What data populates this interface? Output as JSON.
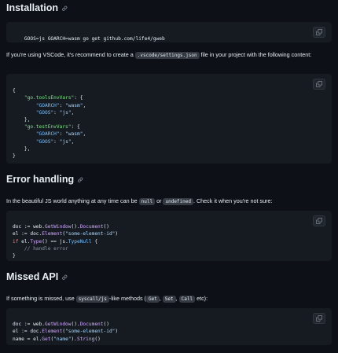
{
  "installation": {
    "heading": "Installation",
    "install_cmd": "GOOS=js GOARCH=wasm go get github.com/life4/gweb",
    "vscode_text_before": "If you're using VSCode, it's recommend to create a",
    "vscode_settings_path": ".vscode/settings.json",
    "vscode_text_after": "file in your project with the following content:",
    "settings_lines": [
      "{",
      "    \"go.toolsEnvVars\": {",
      "        \"GOARCH\": \"wasm\",",
      "        \"GOOS\": \"js\",",
      "    },",
      "    \"go.testEnvVars\": {",
      "        \"GOARCH\": \"wasm\",",
      "        \"GOOS\": \"js\",",
      "    },",
      "}"
    ]
  },
  "error_handling": {
    "heading": "Error handling",
    "text_before": "In the beautiful JS world anything at any time can be",
    "null_code": "null",
    "or_text": "or",
    "undefined_code": "undefined",
    "text_after": ". Check it when you're not sure:",
    "code": {
      "line1_a": "doc := web.",
      "line1_fn": "GetWindow",
      "line1_b": "().",
      "line1_fn2": "Document",
      "line1_c": "()",
      "line2_a": "el := doc.",
      "line2_fn": "Element",
      "line2_b": "(",
      "line2_str": "\"some-element-id\"",
      "line2_c": ")",
      "line3_kw": "if",
      "line3_a": " el.",
      "line3_fn": "Type",
      "line3_b": "() == js.",
      "line3_prop": "TypeNull",
      "line3_c": " {",
      "line4_comment": "    // handle error",
      "line5": "}"
    }
  },
  "missed_api": {
    "heading": "Missed API",
    "text_before": "If something is missed, use",
    "syscall_code": "syscall/js",
    "text_mid": "-like methods (",
    "get_code": "Get",
    "sep1": ",",
    "set_code": "Set",
    "sep2": ",",
    "call_code": "Call",
    "text_after": "etc):",
    "code": {
      "line1_a": "doc := web.",
      "line1_fn": "GetWindow",
      "line1_b": "().",
      "line1_fn2": "Document",
      "line1_c": "()",
      "line2_a": "el := doc.",
      "line2_fn": "Element",
      "line2_b": "(",
      "line2_str": "\"some-element-id\"",
      "line2_c": ")",
      "line3_a": "name = el.",
      "line3_fn": "Get",
      "line3_b": "(",
      "line3_str": "\"name\"",
      "line3_c": ").",
      "line3_fn2": "String",
      "line3_d": "()"
    }
  },
  "icons": {
    "anchor": "link-icon",
    "copy": "copy-icon"
  }
}
